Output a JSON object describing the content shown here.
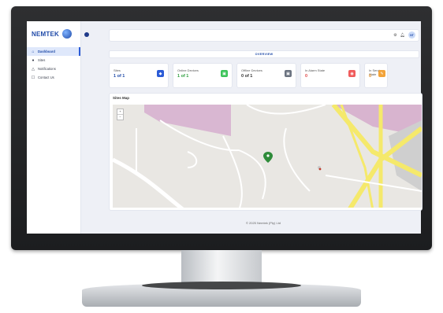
{
  "brand": {
    "name": "NEMTEK"
  },
  "sidebar": {
    "items": [
      {
        "label": "Dashboard",
        "icon": "home-icon"
      },
      {
        "label": "Sites",
        "icon": "pin-icon"
      },
      {
        "label": "Notifications",
        "icon": "bell-icon"
      },
      {
        "label": "Contact Us",
        "icon": "phone-icon"
      }
    ]
  },
  "topbar": {
    "avatar_initials": "NT"
  },
  "overview": {
    "label": "OVERVIEW"
  },
  "cards": [
    {
      "label": "Sites",
      "value": "1 of 1",
      "value_color": "#1f4aa8",
      "icon_color": "#2b5bd6"
    },
    {
      "label": "Online Devices",
      "value": "1 of 1",
      "value_color": "#2e9e3e",
      "icon_color": "#3cc45a"
    },
    {
      "label": "Offline Devices",
      "value": "0 of 1",
      "value_color": "#333333",
      "icon_color": "#6b7380"
    },
    {
      "label": "In Alarm State",
      "value": "0",
      "value_color": "#e04646",
      "icon_color": "#f05c5c"
    },
    {
      "label": "In Service State",
      "value": "0",
      "value_color": "#e08a1e",
      "icon_color": "#f2a33a"
    }
  ],
  "map": {
    "title": "Sites Map",
    "zoom_in": "+",
    "zoom_out": "−"
  },
  "footer": {
    "text": "© 2025 Nemtek (Pty) Ltd"
  }
}
